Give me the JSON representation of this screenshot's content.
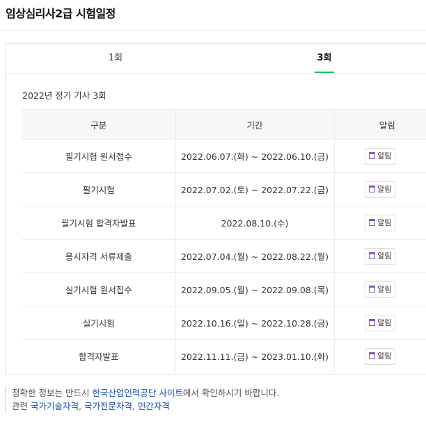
{
  "header": {
    "title": "임상심리사2급 시험일정"
  },
  "tabs": [
    {
      "label": "1회"
    },
    {
      "label": "3회"
    }
  ],
  "section": {
    "title": "2022년 정기 기사 3회"
  },
  "table": {
    "headers": [
      "구분",
      "기간",
      "알림"
    ],
    "rows": [
      {
        "item": "필기시험 원서접수",
        "period": "2022.06.07.(화) ~ 2022.06.10.(금)",
        "alarm": "알림"
      },
      {
        "item": "필기시험",
        "period": "2022.07.02.(토) ~ 2022.07.22.(금)",
        "alarm": "알림"
      },
      {
        "item": "필기시험 합격자발표",
        "period": "2022.08.10.(수)",
        "alarm": "알림"
      },
      {
        "item": "응시자격 서류제출",
        "period": "2022.07.04.(월) ~ 2022.08.22.(월)",
        "alarm": "알림"
      },
      {
        "item": "실기시험 원서접수",
        "period": "2022.09.05.(월) ~ 2022.09.08.(목)",
        "alarm": "알림"
      },
      {
        "item": "실기시험",
        "period": "2022.10.16.(일) ~ 2022.10.28.(금)",
        "alarm": "알림"
      },
      {
        "item": "합격자발표",
        "period": "2022.11.11.(금) ~ 2023.01.10.(화)",
        "alarm": "알림"
      }
    ]
  },
  "notice": {
    "line1_prefix": "정확한 정보는 반드시 ",
    "line1_link": "한국산업인력공단 사이트",
    "line1_suffix": "에서 확인하시기 바랍니다.",
    "line2_prefix": "관련 ",
    "line2_links": [
      "국가기술자격",
      "국가전문자격",
      "민간자격"
    ]
  },
  "colors": {
    "accent": "#03c75a",
    "link": "#1a4fb0",
    "icon": "#8a4fd8"
  }
}
